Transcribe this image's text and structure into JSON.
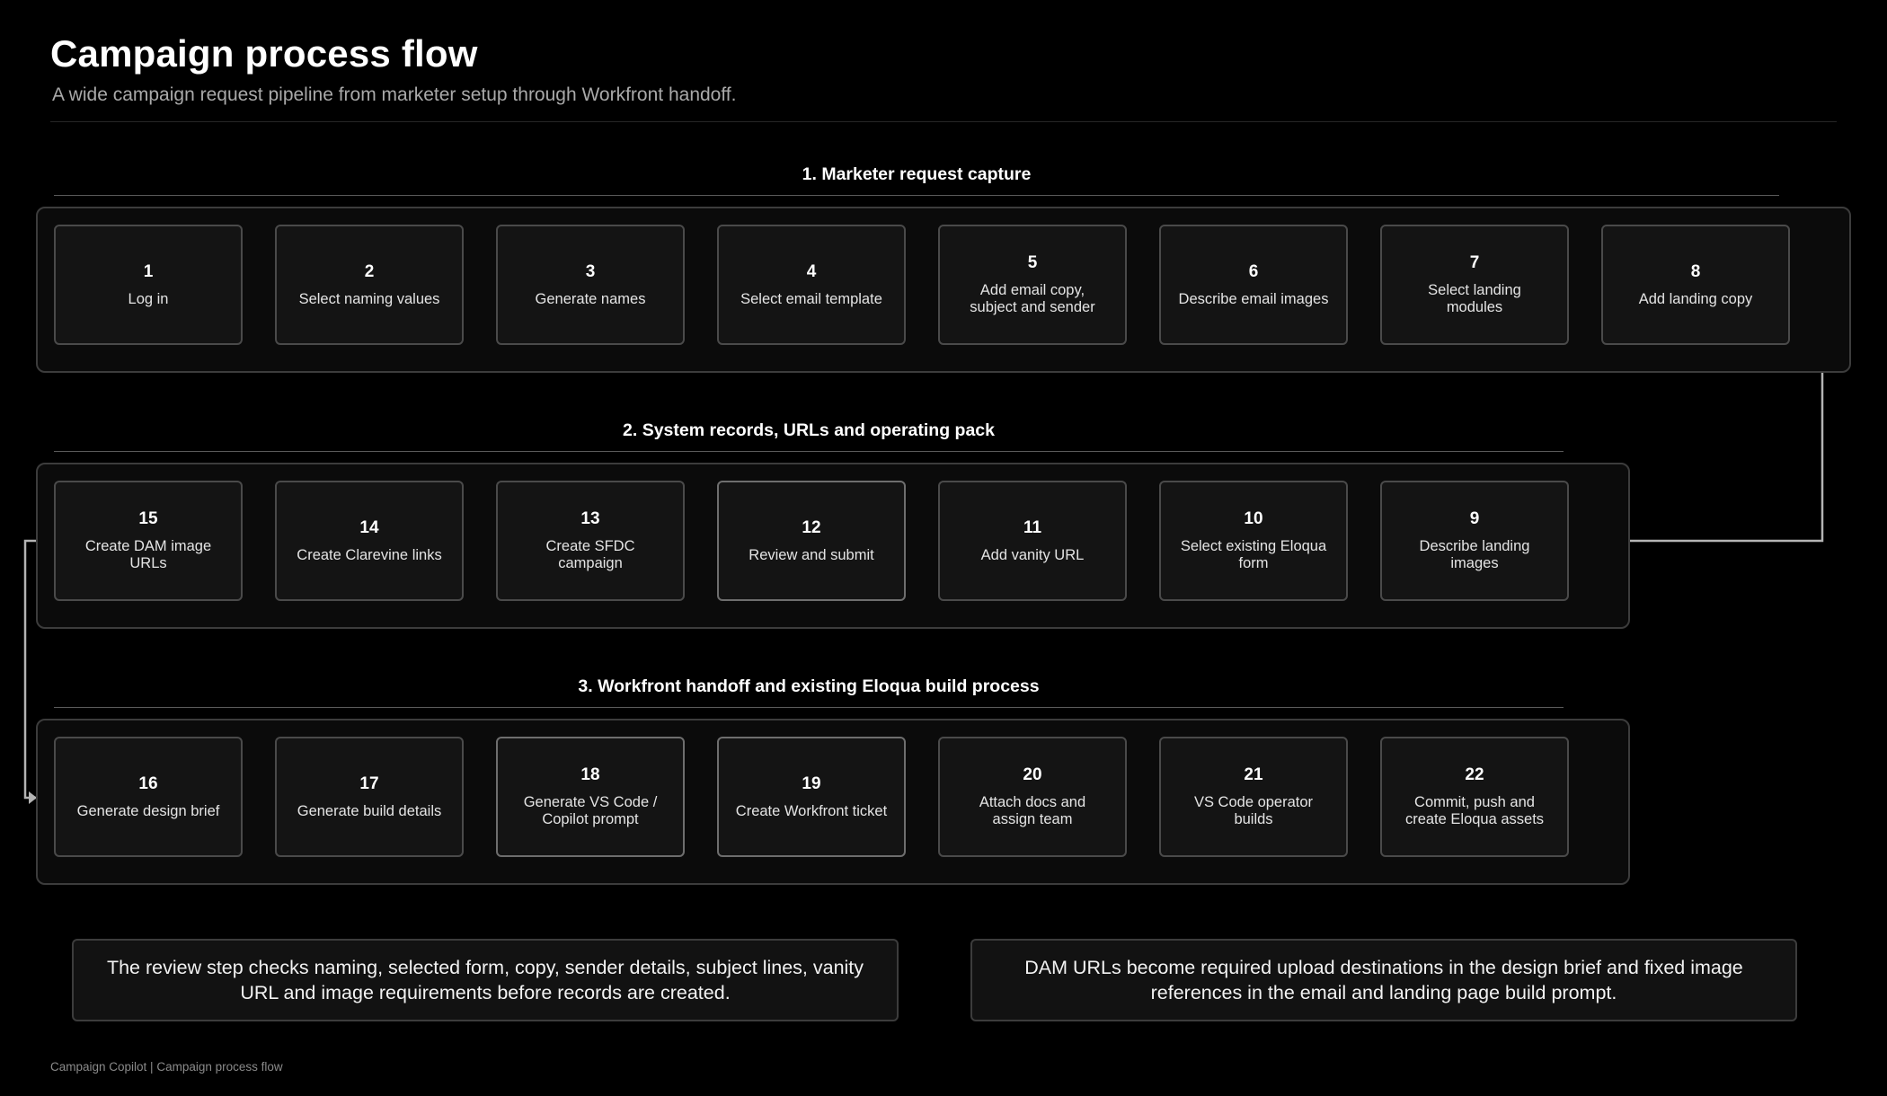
{
  "page": {
    "title": "Campaign process flow",
    "subtitle": "A wide campaign request pipeline from marketer setup through Workfront handoff.",
    "footer": "Campaign Copilot | Campaign process flow"
  },
  "phases": [
    {
      "title": "1. Marketer request capture",
      "steps": [
        {
          "num": "1",
          "label": "Log in"
        },
        {
          "num": "2",
          "label": "Select naming values"
        },
        {
          "num": "3",
          "label": "Generate names"
        },
        {
          "num": "4",
          "label": "Select email template"
        },
        {
          "num": "5",
          "label": "Add email copy, subject and sender"
        },
        {
          "num": "6",
          "label": "Describe email images"
        },
        {
          "num": "7",
          "label": "Select landing modules"
        },
        {
          "num": "8",
          "label": "Add landing copy"
        }
      ]
    },
    {
      "title": "2. System records, URLs and operating pack",
      "steps": [
        {
          "num": "15",
          "label": "Create DAM image URLs"
        },
        {
          "num": "14",
          "label": "Create Clarevine links"
        },
        {
          "num": "13",
          "label": "Create SFDC campaign"
        },
        {
          "num": "12",
          "label": "Review and submit"
        },
        {
          "num": "11",
          "label": "Add vanity URL"
        },
        {
          "num": "10",
          "label": "Select existing Eloqua form"
        },
        {
          "num": "9",
          "label": "Describe landing images"
        }
      ]
    },
    {
      "title": "3. Workfront handoff and existing Eloqua build process",
      "steps": [
        {
          "num": "16",
          "label": "Generate design brief"
        },
        {
          "num": "17",
          "label": "Generate build details"
        },
        {
          "num": "18",
          "label": "Generate VS Code / Copilot prompt"
        },
        {
          "num": "19",
          "label": "Create Workfront ticket"
        },
        {
          "num": "20",
          "label": "Attach docs and assign team"
        },
        {
          "num": "21",
          "label": "VS Code operator builds"
        },
        {
          "num": "22",
          "label": "Commit, push and create Eloqua assets"
        }
      ]
    }
  ],
  "notes": [
    {
      "text": "The review step checks naming, selected form, copy, sender details, subject lines, vanity URL and image requirements before records are created."
    },
    {
      "text": "DAM URLs become required upload destinations in the design brief and fixed image references in the email and landing page build prompt."
    }
  ],
  "colors": {
    "background": "#000000",
    "box_border": "#4a4a4a",
    "connector": "#b4b4b4"
  }
}
